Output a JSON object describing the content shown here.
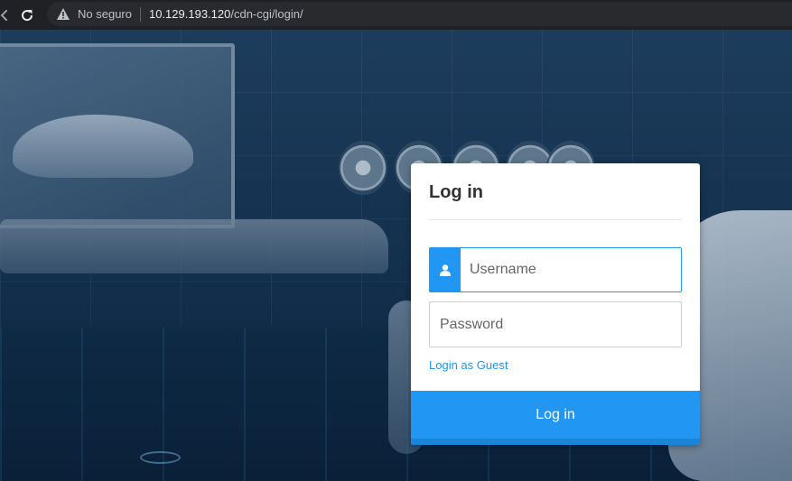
{
  "browser": {
    "security_label": "No seguro",
    "url_host": "10.129.193.120",
    "url_path": "/cdn-cgi/login/"
  },
  "login": {
    "title": "Log in",
    "username_placeholder": "Username",
    "username_value": "",
    "password_placeholder": "Password",
    "password_value": "",
    "guest_link": "Login as Guest",
    "submit_label": "Log in"
  },
  "icons": {
    "back": "arrow-left-icon",
    "reload": "reload-icon",
    "warning": "warning-triangle-icon",
    "user": "user-icon"
  },
  "colors": {
    "accent": "#2196f3",
    "browser_bg": "#202124"
  }
}
